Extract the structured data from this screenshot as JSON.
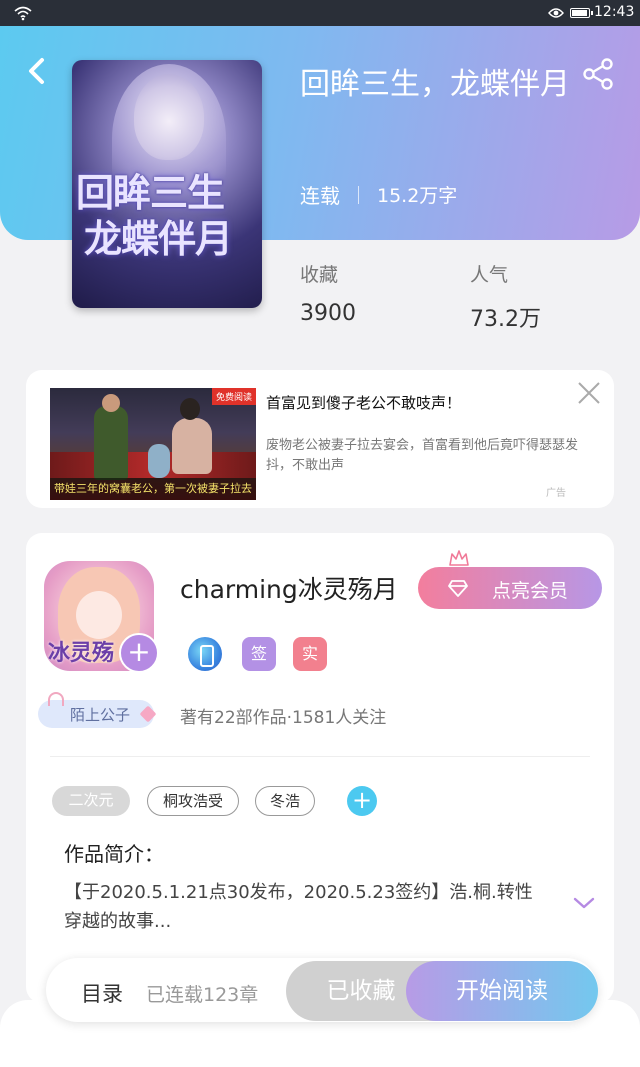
{
  "status_bar": {
    "time": "12:43",
    "icons": [
      "wifi-icon",
      "eye-icon",
      "battery-icon"
    ]
  },
  "header": {
    "back_icon": "back-arrow-icon",
    "share_icon": "share-icon",
    "title": "回眸三生，龙蝶伴月",
    "status": "连载",
    "word_count": "15.2万字",
    "colors": {
      "gradient_start": "#5ccaf0",
      "gradient_end": "#b79be6"
    }
  },
  "cover": {
    "line1": "回眸三生",
    "line2": "龙蝶伴月"
  },
  "stats": [
    {
      "label": "收藏",
      "value": "3900"
    },
    {
      "label": "人气",
      "value": "73.2万"
    }
  ],
  "ad": {
    "title": "首富见到傻子老公不敢吱声！",
    "description": "废物老公被妻子拉去宴会，首富看到他后竟吓得瑟瑟发抖，不敢出声",
    "image_caption": "带娃三年的窝囊老公，第一次被妻子拉去",
    "image_badge": "免费阅读",
    "mark": "广告",
    "close_icon": "close-icon"
  },
  "author": {
    "name": "charming冰灵殇月",
    "avatar_text": "冰灵殇",
    "vip_button": "点亮会员",
    "badges": {
      "phone_icon": "phone-icon",
      "sign": "签",
      "real": "实"
    },
    "nickname_badge": "陌上公子",
    "works": "著有22部作品·1581人关注"
  },
  "tags": [
    "二次元",
    "桐攻浩受",
    "冬浩"
  ],
  "intro": {
    "heading": "作品简介：",
    "text": "【于2020.5.1.21点30发布，2020.5.23签约】浩.桐.转性穿越的故事..."
  },
  "bottom_bar": {
    "toc_label": "目录",
    "chapters": "已连载123章",
    "favorited_label": "已收藏",
    "read_label": "开始阅读"
  }
}
